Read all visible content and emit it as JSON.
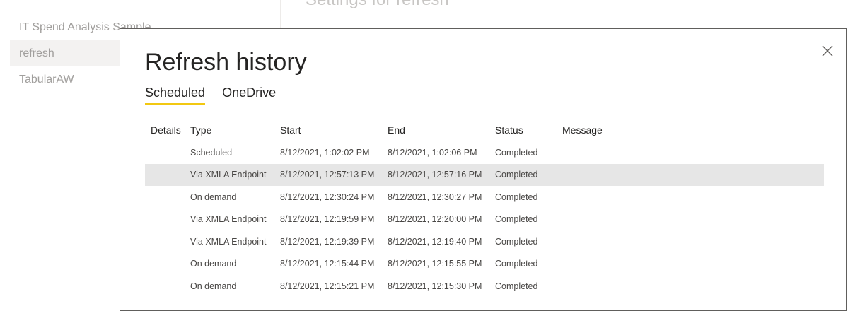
{
  "background": {
    "header_text": "Settings for refresh",
    "datasets": [
      {
        "label": "IT Spend Analysis Sample",
        "selected": false
      },
      {
        "label": "refresh",
        "selected": true
      },
      {
        "label": "TabularAW",
        "selected": false
      }
    ]
  },
  "dialog": {
    "title": "Refresh history",
    "close_icon": "close-icon",
    "tabs": [
      {
        "label": "Scheduled",
        "active": true
      },
      {
        "label": "OneDrive",
        "active": false
      }
    ],
    "table": {
      "headers": {
        "details": "Details",
        "type": "Type",
        "start": "Start",
        "end": "End",
        "status": "Status",
        "message": "Message"
      },
      "rows": [
        {
          "type": "Scheduled",
          "start": "8/12/2021, 1:02:02 PM",
          "end": "8/12/2021, 1:02:06 PM",
          "status": "Completed",
          "message": ""
        },
        {
          "type": "Via XMLA Endpoint",
          "start": "8/12/2021, 12:57:13 PM",
          "end": "8/12/2021, 12:57:16 PM",
          "status": "Completed",
          "message": ""
        },
        {
          "type": "On demand",
          "start": "8/12/2021, 12:30:24 PM",
          "end": "8/12/2021, 12:30:27 PM",
          "status": "Completed",
          "message": ""
        },
        {
          "type": "Via XMLA Endpoint",
          "start": "8/12/2021, 12:19:59 PM",
          "end": "8/12/2021, 12:20:00 PM",
          "status": "Completed",
          "message": ""
        },
        {
          "type": "Via XMLA Endpoint",
          "start": "8/12/2021, 12:19:39 PM",
          "end": "8/12/2021, 12:19:40 PM",
          "status": "Completed",
          "message": ""
        },
        {
          "type": "On demand",
          "start": "8/12/2021, 12:15:44 PM",
          "end": "8/12/2021, 12:15:55 PM",
          "status": "Completed",
          "message": ""
        },
        {
          "type": "On demand",
          "start": "8/12/2021, 12:15:21 PM",
          "end": "8/12/2021, 12:15:30 PM",
          "status": "Completed",
          "message": ""
        }
      ]
    }
  },
  "colors": {
    "tab_underline": "#f2c811",
    "row_highlight": "#e6e6e6"
  }
}
